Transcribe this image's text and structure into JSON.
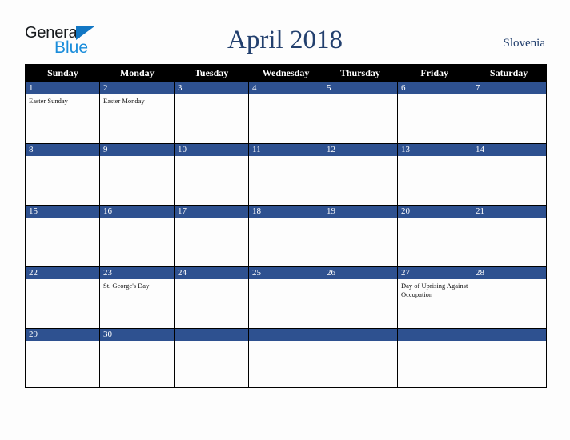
{
  "brand": {
    "name_part1": "General",
    "name_part2": "Blue",
    "triangle_color": "#1277c4",
    "blue_color": "#1a8ddb"
  },
  "header": {
    "title": "April 2018",
    "country": "Slovenia",
    "title_color": "#23406e"
  },
  "colors": {
    "weekday_header_bg": "#000000",
    "weekday_header_text": "#ffffff",
    "day_band_bg": "#2e5190",
    "day_band_text": "#ffffff",
    "cell_bg": "#fdfdfd",
    "grid_line": "#000000",
    "page_bg": "#fdfdfd"
  },
  "calendar": {
    "weekdays": [
      "Sunday",
      "Monday",
      "Tuesday",
      "Wednesday",
      "Thursday",
      "Friday",
      "Saturday"
    ],
    "weeks": [
      [
        {
          "day": "1",
          "events": [
            "Easter Sunday"
          ]
        },
        {
          "day": "2",
          "events": [
            "Easter Monday"
          ]
        },
        {
          "day": "3",
          "events": []
        },
        {
          "day": "4",
          "events": []
        },
        {
          "day": "5",
          "events": []
        },
        {
          "day": "6",
          "events": []
        },
        {
          "day": "7",
          "events": []
        }
      ],
      [
        {
          "day": "8",
          "events": []
        },
        {
          "day": "9",
          "events": []
        },
        {
          "day": "10",
          "events": []
        },
        {
          "day": "11",
          "events": []
        },
        {
          "day": "12",
          "events": []
        },
        {
          "day": "13",
          "events": []
        },
        {
          "day": "14",
          "events": []
        }
      ],
      [
        {
          "day": "15",
          "events": []
        },
        {
          "day": "16",
          "events": []
        },
        {
          "day": "17",
          "events": []
        },
        {
          "day": "18",
          "events": []
        },
        {
          "day": "19",
          "events": []
        },
        {
          "day": "20",
          "events": []
        },
        {
          "day": "21",
          "events": []
        }
      ],
      [
        {
          "day": "22",
          "events": []
        },
        {
          "day": "23",
          "events": [
            "St. George's Day"
          ]
        },
        {
          "day": "24",
          "events": []
        },
        {
          "day": "25",
          "events": []
        },
        {
          "day": "26",
          "events": []
        },
        {
          "day": "27",
          "events": [
            "Day of Uprising Against Occupation"
          ]
        },
        {
          "day": "28",
          "events": []
        }
      ],
      [
        {
          "day": "29",
          "events": []
        },
        {
          "day": "30",
          "events": []
        },
        {
          "day": "",
          "events": []
        },
        {
          "day": "",
          "events": []
        },
        {
          "day": "",
          "events": []
        },
        {
          "day": "",
          "events": []
        },
        {
          "day": "",
          "events": []
        }
      ]
    ]
  }
}
